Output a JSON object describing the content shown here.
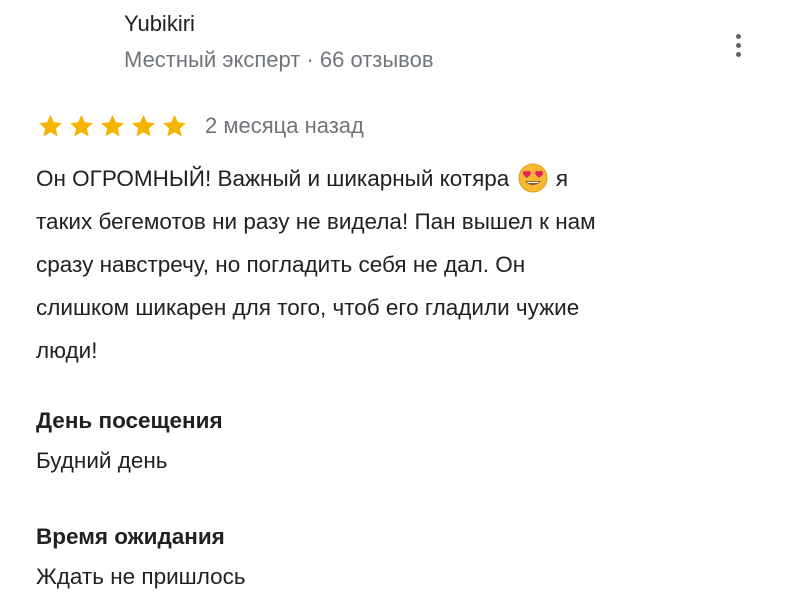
{
  "author": {
    "name": "Yubikiri",
    "meta": "Местный эксперт · 66 отзывов"
  },
  "review": {
    "stars": 5,
    "star_color": "#f4b400",
    "date": "2 месяца назад",
    "text_before_emoji": "Он ОГРОМНЫЙ! Важный и шикарный котяра",
    "emoji": "heart-eyes-emoji",
    "text_after_emoji": "я\nтаких бегемотов ни разу не видела! Пан вышел к нам\nсразу навстречу, но погладить себя не дал. Он\nслишком шикарен для того, чтоб его гладили чужие\nлюди!"
  },
  "attributes": [
    {
      "label": "День посещения",
      "value": "Будний день"
    },
    {
      "label": "Время ожидания",
      "value": "Ждать не пришлось"
    }
  ]
}
